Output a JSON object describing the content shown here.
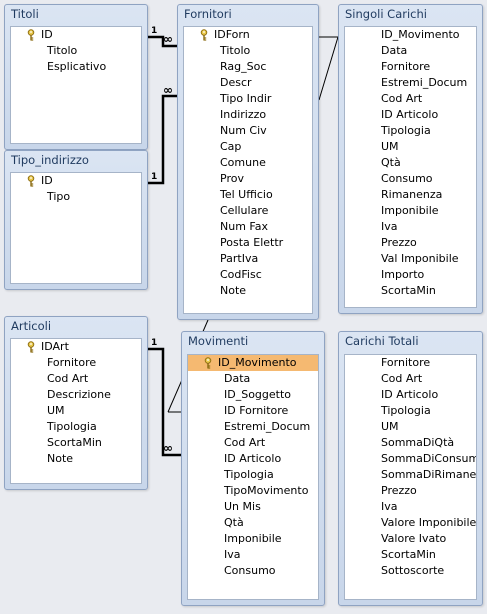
{
  "tables": {
    "titoli": {
      "title": "Titoli",
      "fields": [
        {
          "label": "ID",
          "key": true
        },
        {
          "label": "Titolo"
        },
        {
          "label": "Esplicativo"
        }
      ]
    },
    "tipo_indirizzo": {
      "title": "Tipo_indirizzo",
      "fields": [
        {
          "label": "ID",
          "key": true
        },
        {
          "label": "Tipo"
        }
      ]
    },
    "fornitori": {
      "title": "Fornitori",
      "fields": [
        {
          "label": "IDForn",
          "key": true
        },
        {
          "label": "Titolo"
        },
        {
          "label": "Rag_Soc"
        },
        {
          "label": "Descr"
        },
        {
          "label": "Tipo Indir"
        },
        {
          "label": "Indirizzo"
        },
        {
          "label": "Num Civ"
        },
        {
          "label": "Cap"
        },
        {
          "label": "Comune"
        },
        {
          "label": "Prov"
        },
        {
          "label": "Tel Ufficio"
        },
        {
          "label": "Cellulare"
        },
        {
          "label": "Num Fax"
        },
        {
          "label": "Posta Elettr"
        },
        {
          "label": "PartIva"
        },
        {
          "label": "CodFisc"
        },
        {
          "label": "Note"
        }
      ]
    },
    "singoli_carichi": {
      "title": "Singoli Carichi",
      "fields": [
        {
          "label": "ID_Movimento"
        },
        {
          "label": "Data"
        },
        {
          "label": "Fornitore"
        },
        {
          "label": "Estremi_Docum"
        },
        {
          "label": "Cod Art"
        },
        {
          "label": "ID Articolo"
        },
        {
          "label": "Tipologia"
        },
        {
          "label": "UM"
        },
        {
          "label": "Qtà"
        },
        {
          "label": "Consumo"
        },
        {
          "label": "Rimanenza"
        },
        {
          "label": "Imponibile"
        },
        {
          "label": "Iva"
        },
        {
          "label": "Prezzo"
        },
        {
          "label": "Val Imponibile"
        },
        {
          "label": "Importo"
        },
        {
          "label": "ScortaMin"
        }
      ]
    },
    "articoli": {
      "title": "Articoli",
      "fields": [
        {
          "label": "IDArt",
          "key": true
        },
        {
          "label": "Fornitore"
        },
        {
          "label": "Cod Art"
        },
        {
          "label": "Descrizione"
        },
        {
          "label": "UM"
        },
        {
          "label": "Tipologia"
        },
        {
          "label": "ScortaMin"
        },
        {
          "label": "Note"
        }
      ]
    },
    "movimenti": {
      "title": "Movimenti",
      "fields": [
        {
          "label": "ID_Movimento",
          "key": true,
          "selected": true
        },
        {
          "label": "Data"
        },
        {
          "label": "ID_Soggetto"
        },
        {
          "label": "ID Fornitore"
        },
        {
          "label": "Estremi_Docum"
        },
        {
          "label": "Cod Art"
        },
        {
          "label": "ID Articolo"
        },
        {
          "label": "Tipologia"
        },
        {
          "label": "TipoMovimento"
        },
        {
          "label": "Un Mis"
        },
        {
          "label": "Qtà"
        },
        {
          "label": "Imponibile"
        },
        {
          "label": "Iva"
        },
        {
          "label": "Consumo"
        }
      ]
    },
    "carichi_totali": {
      "title": "Carichi Totali",
      "fields": [
        {
          "label": "Fornitore"
        },
        {
          "label": "Cod Art"
        },
        {
          "label": "ID Articolo"
        },
        {
          "label": "Tipologia"
        },
        {
          "label": "UM"
        },
        {
          "label": "SommaDiQtà"
        },
        {
          "label": "SommaDiConsumo"
        },
        {
          "label": "SommaDiRimanenza"
        },
        {
          "label": "Prezzo"
        },
        {
          "label": "Iva"
        },
        {
          "label": "Valore Imponibile"
        },
        {
          "label": "Valore Ivato"
        },
        {
          "label": "ScortaMin"
        },
        {
          "label": "Sottoscorte"
        }
      ]
    }
  },
  "relationships": [
    {
      "from": "titoli",
      "to": "fornitori",
      "one": "1",
      "many": "∞"
    },
    {
      "from": "tipo_indirizzo",
      "to": "fornitori",
      "one": "1",
      "many": "∞"
    },
    {
      "from": "articoli",
      "to": "movimenti",
      "one": "1",
      "many": "∞"
    }
  ],
  "colors": {
    "selected_row": "#f5b971",
    "table_border": "#8fa3c2",
    "key_icon": "#c8a020"
  }
}
